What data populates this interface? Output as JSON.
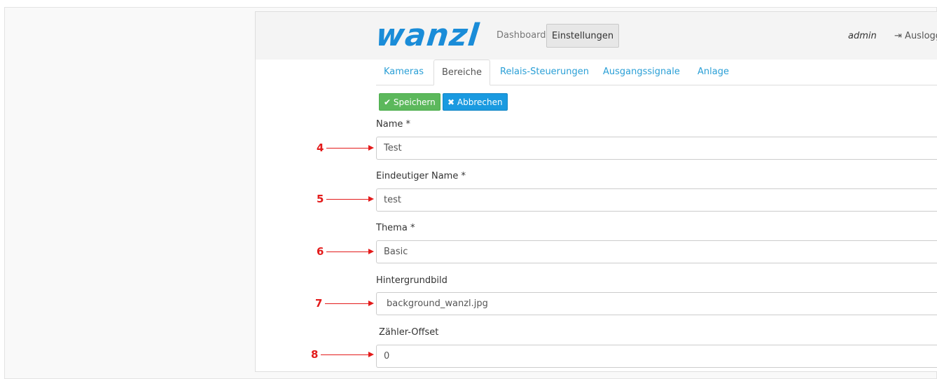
{
  "header": {
    "logo_text": "wanzl",
    "nav_dashboard": "Dashboard",
    "nav_settings": "Einstellungen",
    "user": "admin",
    "logout": "Ausloggen"
  },
  "tabs": [
    {
      "label": "Kameras"
    },
    {
      "label": "Bereiche",
      "active": true
    },
    {
      "label": "Relais-Steuerungen"
    },
    {
      "label": "Ausgangssignale"
    },
    {
      "label": "Anlage"
    }
  ],
  "actions": {
    "save_label": "Speichern",
    "cancel_label": "Abbrechen"
  },
  "form": {
    "fields": [
      {
        "label": "Name *",
        "value": "Test",
        "marker": "4"
      },
      {
        "label": "Eindeutiger Name *",
        "value": "test",
        "marker": "5"
      },
      {
        "label": "Thema *",
        "value": "Basic",
        "marker": "6"
      },
      {
        "label": "Hintergrundbild",
        "value": "background_wanzl.jpg",
        "marker": "7"
      },
      {
        "label": "Zähler-Offset",
        "value": "0",
        "marker": "8"
      }
    ]
  },
  "colors": {
    "brand": "#1a8cd8",
    "save": "#5cb85c",
    "cancel": "#1a9ae0",
    "annotation": "#e31b1b"
  }
}
